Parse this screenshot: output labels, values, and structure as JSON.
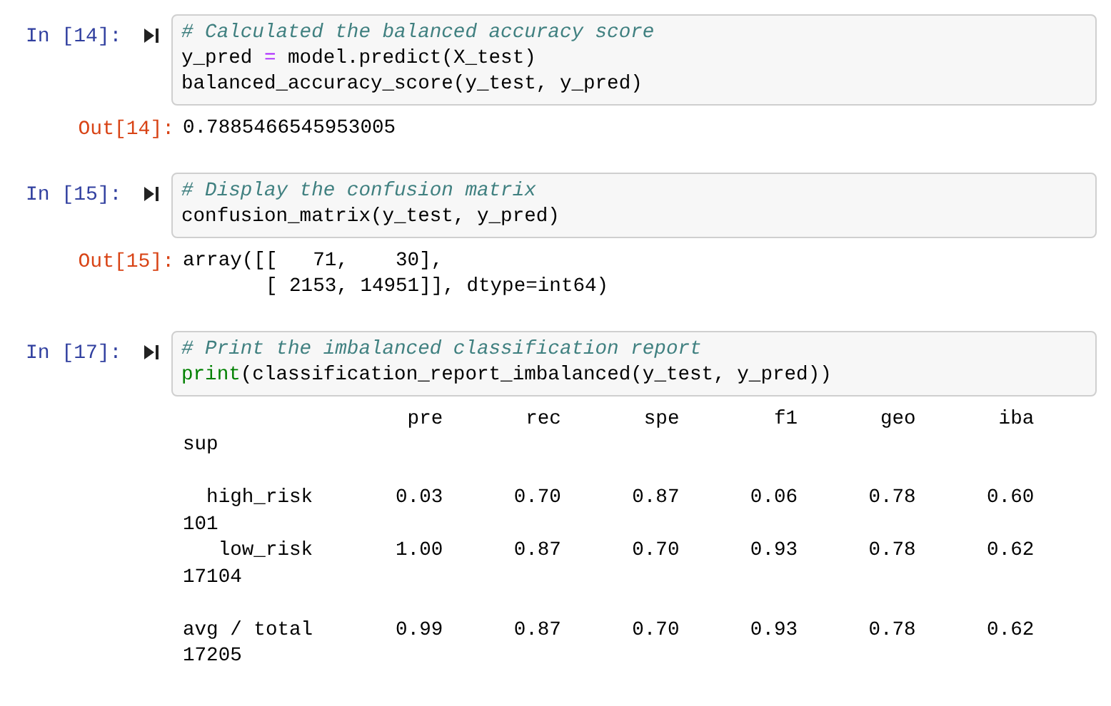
{
  "cells": [
    {
      "prompt": "In [14]:",
      "code": [
        [
          {
            "kind": "comment",
            "text": "# Calculated the balanced accuracy score"
          }
        ],
        [
          {
            "kind": "plain",
            "text": "y_pred "
          },
          {
            "kind": "operator",
            "text": "="
          },
          {
            "kind": "plain",
            "text": " model.predict(X_test)"
          }
        ],
        [
          {
            "kind": "plain",
            "text": "balanced_accuracy_score(y_test, y_pred)"
          }
        ]
      ],
      "out_prompt": "Out[14]:",
      "output": [
        "0.7885466545953005"
      ]
    },
    {
      "prompt": "In [15]:",
      "code": [
        [
          {
            "kind": "comment",
            "text": "# Display the confusion matrix"
          }
        ],
        [
          {
            "kind": "plain",
            "text": "confusion_matrix(y_test, y_pred)"
          }
        ]
      ],
      "out_prompt": "Out[15]:",
      "output": [
        "array([[   71,    30],",
        "       [ 2153, 14951]], dtype=int64)"
      ]
    },
    {
      "prompt": "In [17]:",
      "code": [
        [
          {
            "kind": "comment",
            "text": "# Print the imbalanced classification report"
          }
        ],
        [
          {
            "kind": "builtin",
            "text": "print"
          },
          {
            "kind": "plain",
            "text": "(classification_report_imbalanced(y_test, y_pred))"
          }
        ]
      ],
      "output": [
        "                   pre       rec       spe        f1       geo       iba",
        "sup",
        {
          "text": "  high_risk       0.03      0.70      0.87      0.06      0.78      0.60",
          "gap_before": true
        },
        "101",
        "   low_risk       1.00      0.87      0.70      0.93      0.78      0.62",
        "17104",
        {
          "text": "avg / total       0.99      0.87      0.70      0.93      0.78      0.62",
          "gap_before": true
        },
        "17205"
      ]
    }
  ]
}
